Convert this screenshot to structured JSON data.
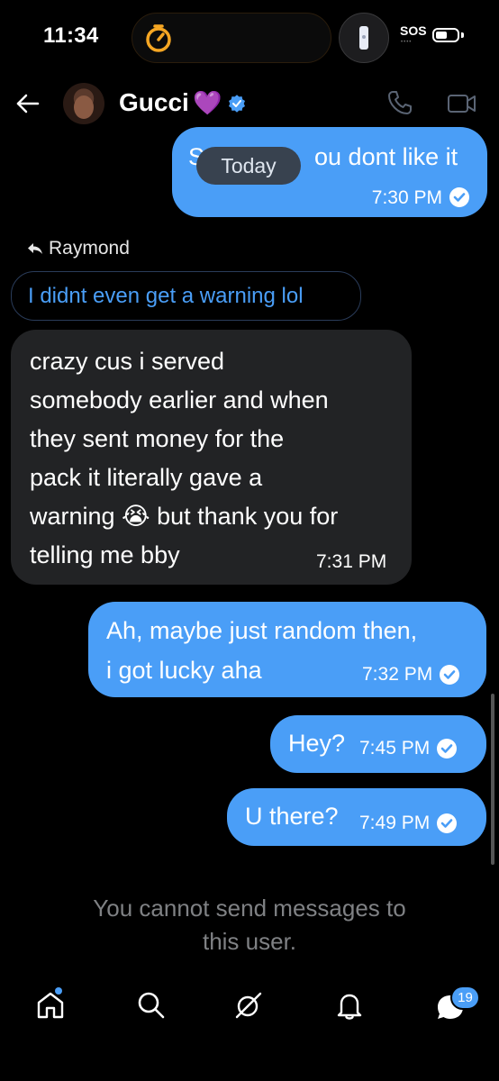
{
  "status_bar": {
    "time": "11:34",
    "sos": "SOS",
    "sos_dots": "••••"
  },
  "header": {
    "contact_name": "Gucci",
    "heart": "💜"
  },
  "messages": [
    {
      "direction": "sent",
      "text": "S",
      "text_tail": "ou dont like it",
      "time": "7:30 PM",
      "read": true
    },
    {
      "direction": "received",
      "reply_to": "Raymond",
      "quoted_text": "I didnt even get a warning lol",
      "text": "crazy cus i served\nsomebody earlier and when\nthey sent money for the\npack it literally gave a\nwarning 😭 but thank you for\ntelling me bby",
      "time": "7:31 PM"
    },
    {
      "direction": "sent",
      "text": "Ah, maybe just random then,\ni got lucky aha",
      "time": "7:32 PM",
      "read": true
    },
    {
      "direction": "sent",
      "text": "Hey?",
      "time": "7:45 PM",
      "read": true
    },
    {
      "direction": "sent",
      "text": "U there?",
      "time": "7:49 PM",
      "read": true
    }
  ],
  "date_chip": "Today",
  "footer_notice": "You cannot send messages to\nthis user.",
  "bottom_nav": {
    "items": [
      "home-icon",
      "search-icon",
      "grok-icon",
      "notifications-icon",
      "messages-icon"
    ],
    "messages_badge": "19"
  },
  "colors": {
    "sent_bubble": "#4a9ef7",
    "received_bubble": "#222325",
    "accent": "#4a9ef7",
    "heart": "#b44ef2"
  }
}
